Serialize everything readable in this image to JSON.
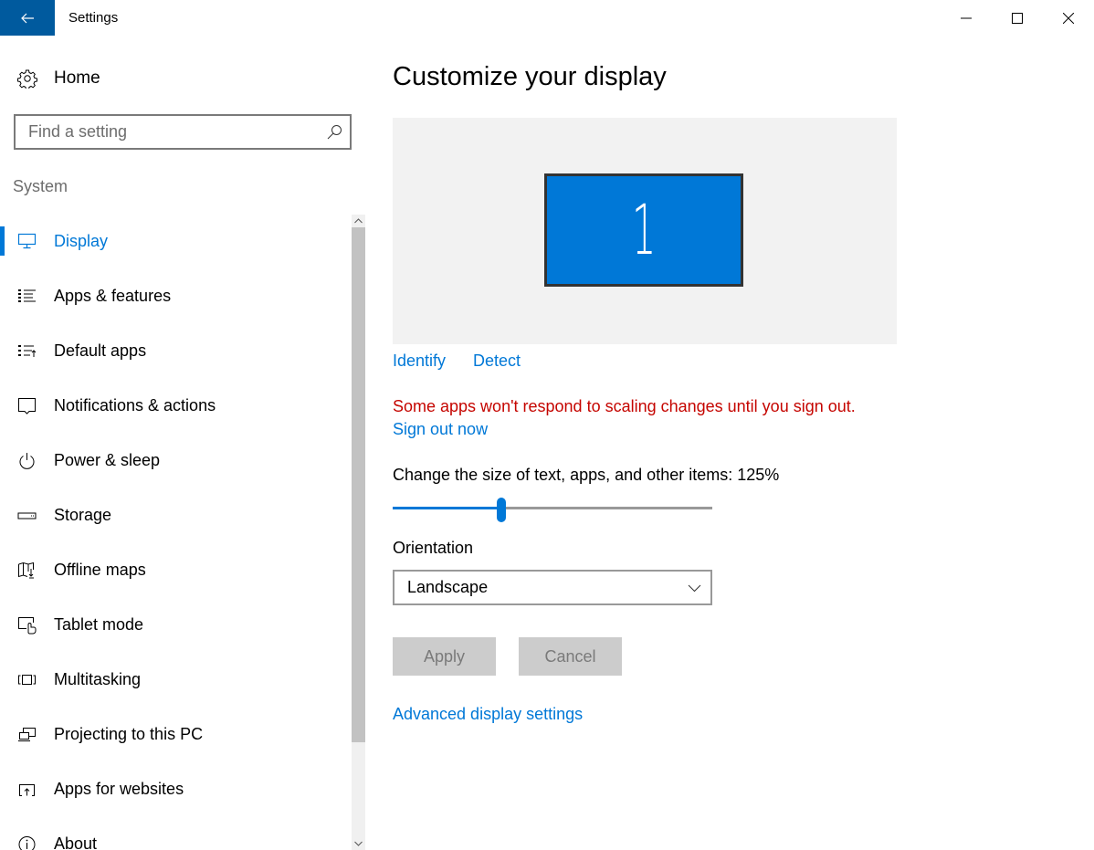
{
  "window": {
    "title": "Settings",
    "controls": {
      "minimize": "minimize-icon",
      "maximize": "maximize-icon",
      "close": "close-icon"
    },
    "back_icon": "back-arrow-icon"
  },
  "sidebar": {
    "home": {
      "label": "Home",
      "icon": "gear-icon"
    },
    "search": {
      "placeholder": "Find a setting",
      "value": "",
      "icon": "search-icon"
    },
    "section_label": "System",
    "items": [
      {
        "label": "Display",
        "icon": "monitor-icon",
        "active": true
      },
      {
        "label": "Apps & features",
        "icon": "list-icon",
        "active": false
      },
      {
        "label": "Default apps",
        "icon": "default-apps-icon",
        "active": false
      },
      {
        "label": "Notifications & actions",
        "icon": "notification-icon",
        "active": false
      },
      {
        "label": "Power & sleep",
        "icon": "power-icon",
        "active": false
      },
      {
        "label": "Storage",
        "icon": "storage-icon",
        "active": false
      },
      {
        "label": "Offline maps",
        "icon": "map-icon",
        "active": false
      },
      {
        "label": "Tablet mode",
        "icon": "tablet-mode-icon",
        "active": false
      },
      {
        "label": "Multitasking",
        "icon": "multitasking-icon",
        "active": false
      },
      {
        "label": "Projecting to this PC",
        "icon": "projecting-icon",
        "active": false
      },
      {
        "label": "Apps for websites",
        "icon": "apps-for-websites-icon",
        "active": false
      },
      {
        "label": "About",
        "icon": "info-icon",
        "active": false
      }
    ]
  },
  "main": {
    "title": "Customize your display",
    "monitor_number": "1",
    "identify_label": "Identify",
    "detect_label": "Detect",
    "warning": "Some apps won't respond to scaling changes until you sign out.",
    "signout_label": "Sign out now",
    "scale": {
      "label": "Change the size of text, apps, and other items: 125%",
      "value_percent": 125,
      "slider_fraction": 0.34
    },
    "orientation": {
      "label": "Orientation",
      "selected": "Landscape"
    },
    "apply_label": "Apply",
    "cancel_label": "Cancel",
    "advanced_label": "Advanced display settings"
  },
  "colors": {
    "accent": "#0078d7",
    "titlebar_back": "#005a9e",
    "warning": "#c50500",
    "disabled_button_bg": "#cccccc",
    "disabled_button_text": "#7a7a7a"
  }
}
